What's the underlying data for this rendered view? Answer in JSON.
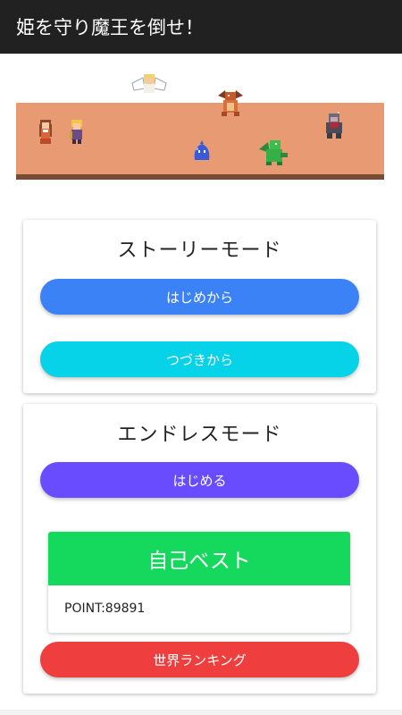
{
  "app_bar": {
    "title": "姫を守り魔王を倒せ！"
  },
  "scene": {
    "ground_color": "#e89a72",
    "characters": [
      "princess-sprite",
      "hero-sprite",
      "angel-sprite",
      "red-dragon-sprite",
      "blue-slime-sprite",
      "green-dragon-sprite",
      "demon-king-sprite"
    ]
  },
  "story_mode": {
    "title": "ストーリーモード",
    "start_label": "はじめから",
    "continue_label": "つづきから"
  },
  "endless_mode": {
    "title": "エンドレスモード",
    "start_label": "はじめる",
    "best": {
      "heading": "自己ベスト",
      "points": "POINT:89891"
    },
    "ranking_label": "世界ランキング"
  },
  "colors": {
    "start_button": "#3b82f6",
    "continue_button": "#06d2e8",
    "endless_button": "#6a4cff",
    "best_header": "#14d95c",
    "ranking_button": "#ef3e3e"
  }
}
